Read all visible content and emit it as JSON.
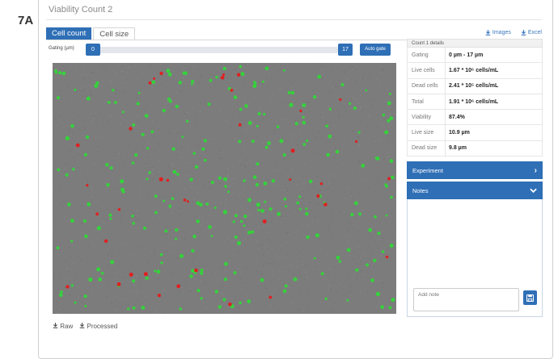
{
  "panel_label": "7A",
  "window_title": "Viability Count 2",
  "tabs": [
    {
      "label": "Cell count",
      "active": true
    },
    {
      "label": "Cell size",
      "active": false
    }
  ],
  "top_links": {
    "images": "Images",
    "excel": "Excel"
  },
  "gating": {
    "label": "Gating (µm)",
    "min": "0",
    "max": "17",
    "auto_gate": "Auto gate"
  },
  "downloads": {
    "raw": "Raw",
    "processed": "Processed"
  },
  "details": {
    "title": "Count 1 details",
    "rows": [
      {
        "key": "Gating",
        "value": "0 µm - 17 µm"
      },
      {
        "key": "Live cells",
        "value": "1.67 * 10⁶ cells/mL"
      },
      {
        "key": "Dead cells",
        "value": "2.41 * 10⁵ cells/mL"
      },
      {
        "key": "Total",
        "value": "1.91 * 10⁶ cells/mL"
      },
      {
        "key": "Viability",
        "value": "87.4%"
      },
      {
        "key": "Live size",
        "value": "10.9 µm"
      },
      {
        "key": "Dead size",
        "value": "9.8 µm"
      }
    ]
  },
  "experiment": {
    "label": "Experiment"
  },
  "notes": {
    "label": "Notes",
    "placeholder": "Add note"
  },
  "colors": {
    "accent": "#2f6fb6",
    "live_cell": "#34d33a",
    "dead_cell": "#e02020",
    "background": "#7c7c7c"
  }
}
